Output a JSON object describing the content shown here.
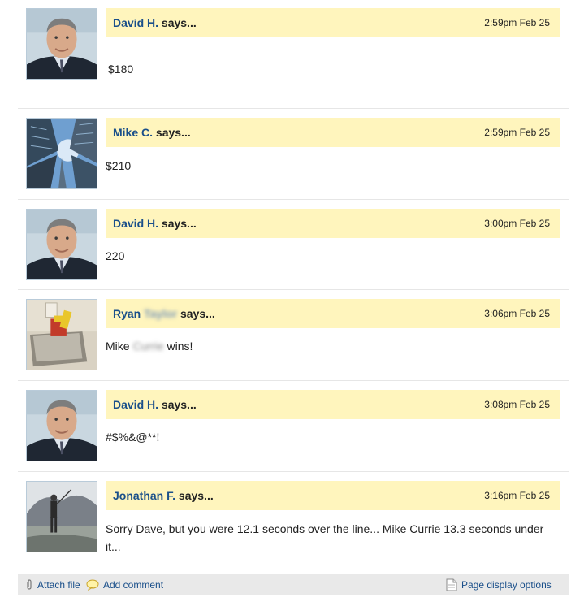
{
  "comments": [
    {
      "author": "David H.",
      "says": "says...",
      "time": "2:59pm Feb 25",
      "text": "$180"
    },
    {
      "author": "Mike C.",
      "says": "says...",
      "time": "2:59pm Feb 25",
      "text": "$210"
    },
    {
      "author": "David H.",
      "says": "says...",
      "time": "3:00pm Feb 25",
      "text": "220"
    },
    {
      "author_first": "Ryan",
      "author_blurred": "Taylor",
      "says": "says...",
      "time": "3:06pm Feb 25",
      "text_start": "Mike ",
      "text_blurred": "Currie",
      "text_end": " wins!"
    },
    {
      "author": "David H.",
      "says": "says...",
      "time": "3:08pm Feb 25",
      "text": "#$%&@**!"
    },
    {
      "author": "Jonathan F.",
      "says": "says...",
      "time": "3:16pm Feb 25",
      "text": "Sorry Dave, but you were 12.1 seconds over the line... Mike Currie 13.3 seconds under it..."
    }
  ],
  "footer": {
    "attach": "Attach file",
    "add_comment": "Add comment",
    "page_options": "Page display options"
  },
  "icons": {
    "attach": "paperclip-icon",
    "comment": "speech-bubble-icon",
    "page": "page-icon"
  },
  "colors": {
    "header_bg": "#fff5bd",
    "author": "#1a4f8a",
    "footer_bg": "#e9e9e9"
  }
}
